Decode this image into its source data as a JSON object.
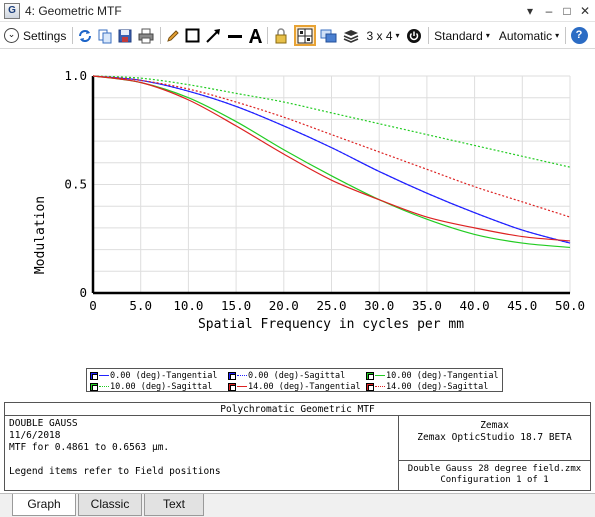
{
  "window": {
    "app_icon_letter": "G",
    "title": "4: Geometric MTF",
    "controls": {
      "menu": "▾",
      "minimize": "–",
      "maximize": "□",
      "close": "✕"
    }
  },
  "toolbar": {
    "settings_label": "Settings",
    "layout_label": "3 x 4",
    "standard_label": "Standard",
    "automatic_label": "Automatic",
    "caret": "▾",
    "help_glyph": "?"
  },
  "chart_data": {
    "type": "line",
    "xlabel": "Spatial Frequency in cycles per mm",
    "ylabel": "Modulation",
    "xlim": [
      0,
      50
    ],
    "ylim": [
      0,
      1
    ],
    "x_ticks": [
      "0",
      "5.0",
      "10.0",
      "15.0",
      "20.0",
      "25.0",
      "30.0",
      "35.0",
      "40.0",
      "45.0",
      "50.0"
    ],
    "y_ticks": [
      "0",
      "0.5",
      "1.0"
    ],
    "grid": true,
    "x": [
      0,
      5,
      10,
      15,
      20,
      25,
      30,
      35,
      40,
      45,
      50
    ],
    "series": [
      {
        "name": "0.00 (deg)-Tangential",
        "color": "#2222ff",
        "dash": "solid",
        "values": [
          1.0,
          0.98,
          0.93,
          0.86,
          0.77,
          0.67,
          0.56,
          0.46,
          0.37,
          0.29,
          0.23
        ]
      },
      {
        "name": "0.00 (deg)-Sagittal",
        "color": "#2222ff",
        "dash": "dotted",
        "values": [
          1.0,
          0.98,
          0.93,
          0.86,
          0.77,
          0.67,
          0.56,
          0.46,
          0.37,
          0.29,
          0.23
        ]
      },
      {
        "name": "10.00 (deg)-Tangential",
        "color": "#22cc22",
        "dash": "solid",
        "values": [
          1.0,
          0.97,
          0.9,
          0.79,
          0.66,
          0.54,
          0.43,
          0.34,
          0.27,
          0.23,
          0.21
        ]
      },
      {
        "name": "10.00 (deg)-Sagittal",
        "color": "#22cc22",
        "dash": "dotted",
        "values": [
          1.0,
          0.99,
          0.96,
          0.92,
          0.88,
          0.83,
          0.78,
          0.73,
          0.68,
          0.63,
          0.58
        ]
      },
      {
        "name": "14.00 (deg)-Tangential",
        "color": "#dd2222",
        "dash": "solid",
        "values": [
          1.0,
          0.97,
          0.89,
          0.77,
          0.64,
          0.52,
          0.43,
          0.35,
          0.3,
          0.26,
          0.24
        ]
      },
      {
        "name": "14.00 (deg)-Sagittal",
        "color": "#dd2222",
        "dash": "dotted",
        "values": [
          1.0,
          0.98,
          0.94,
          0.88,
          0.81,
          0.73,
          0.65,
          0.57,
          0.49,
          0.42,
          0.35
        ]
      }
    ]
  },
  "info": {
    "title": "Polychromatic Geometric MTF",
    "left_lines": [
      "DOUBLE GAUSS",
      "11/6/2018",
      "MTF for 0.4861 to 0.6563 µm.",
      "",
      "Legend items refer to Field positions"
    ],
    "right_top": [
      "Zemax",
      "Zemax OpticStudio 18.7  BETA"
    ],
    "right_bottom": [
      "Double Gauss 28 degree field.zmx",
      "Configuration 1 of 1"
    ]
  },
  "tabs": [
    "Graph",
    "Classic",
    "Text"
  ]
}
